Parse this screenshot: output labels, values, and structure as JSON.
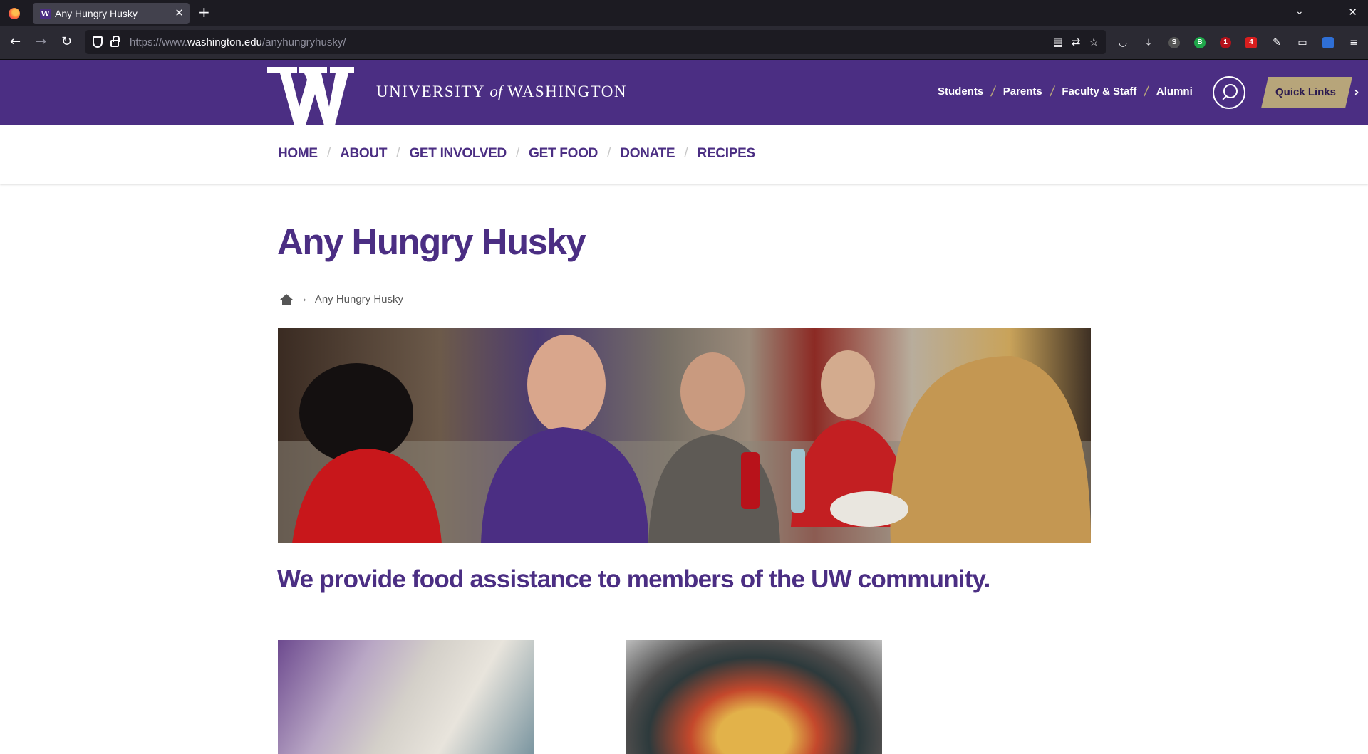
{
  "browser": {
    "tab_title": "Any Hungry Husky",
    "tab_favicon_letter": "W",
    "url_scheme": "https://www.",
    "url_host": "washington.edu",
    "url_path": "/anyhungryhusky/",
    "toolbar_badges": {
      "ext_1": "1",
      "ext_2": "4"
    }
  },
  "header": {
    "wordmark_pre": "UNIVERSITY",
    "wordmark_of": "of",
    "wordmark_post": "WASHINGTON",
    "audience_links": [
      "Students",
      "Parents",
      "Faculty & Staff",
      "Alumni"
    ],
    "quick_links_label": "Quick Links"
  },
  "site_nav": {
    "items": [
      "HOME",
      "ABOUT",
      "GET INVOLVED",
      "GET FOOD",
      "DONATE",
      "RECIPES"
    ]
  },
  "page": {
    "title": "Any Hungry Husky",
    "breadcrumb_current": "Any Hungry Husky",
    "tagline": "We provide food assistance to members of the UW community."
  },
  "colors": {
    "uw_purple": "#4b2e83",
    "uw_gold": "#b7a57a",
    "chrome_dark": "#1c1b22"
  }
}
